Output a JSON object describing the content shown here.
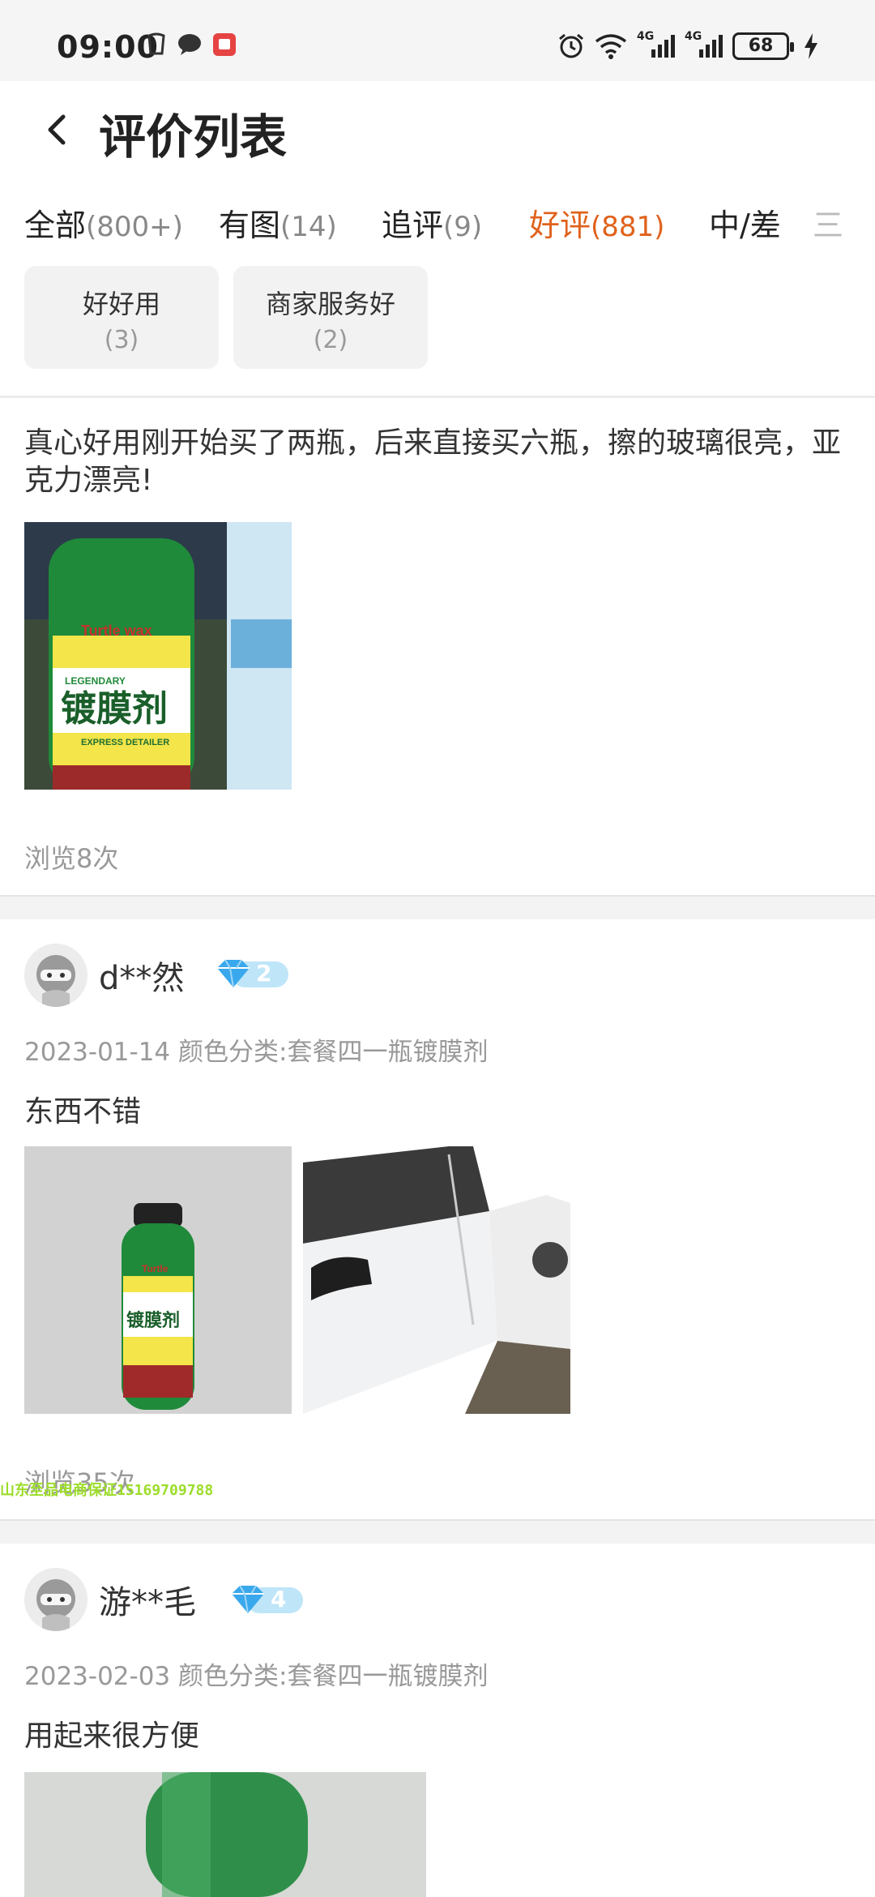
{
  "status": {
    "time": "09:00",
    "battery": "68",
    "net1": "4G",
    "net2": "4G"
  },
  "header": {
    "title": "评价列表"
  },
  "tabs": [
    {
      "label": "全部",
      "count": "(800+)"
    },
    {
      "label": "有图",
      "count": "(14)"
    },
    {
      "label": "追评",
      "count": "(9)"
    },
    {
      "label": "好评",
      "count": "(881)"
    },
    {
      "label": "中/差",
      "count": ""
    },
    {
      "label": "三",
      "count": ""
    }
  ],
  "chips": [
    {
      "label": "好好用",
      "count": "(3)"
    },
    {
      "label": "商家服务好",
      "count": "(2)"
    }
  ],
  "reviews": [
    {
      "text": "真心好用刚开始买了两瓶，后来直接买六瓶，擦的玻璃很亮，亚克力漂亮!",
      "views": "浏览8次",
      "photo_labels": [
        "镀膜剂",
        "LEGENDARY",
        "EXPRESS DETAILER",
        "Turtle wax"
      ]
    },
    {
      "user": "d**然",
      "level": "2",
      "meta": "2023-01-14 颜色分类:套餐四一瓶镀膜剂",
      "text": "东西不错",
      "views": "浏览35次",
      "photo_labels": [
        "镀膜剂",
        "Turtle"
      ]
    },
    {
      "user": "游**毛",
      "level": "4",
      "meta": "2023-02-03 颜色分类:套餐四一瓶镀膜剂",
      "text": "用起来很方便"
    }
  ],
  "watermark": "山东至品电商保证15169709788",
  "colors": {
    "accent": "#e0621c",
    "badge": "#3fb6ee"
  }
}
